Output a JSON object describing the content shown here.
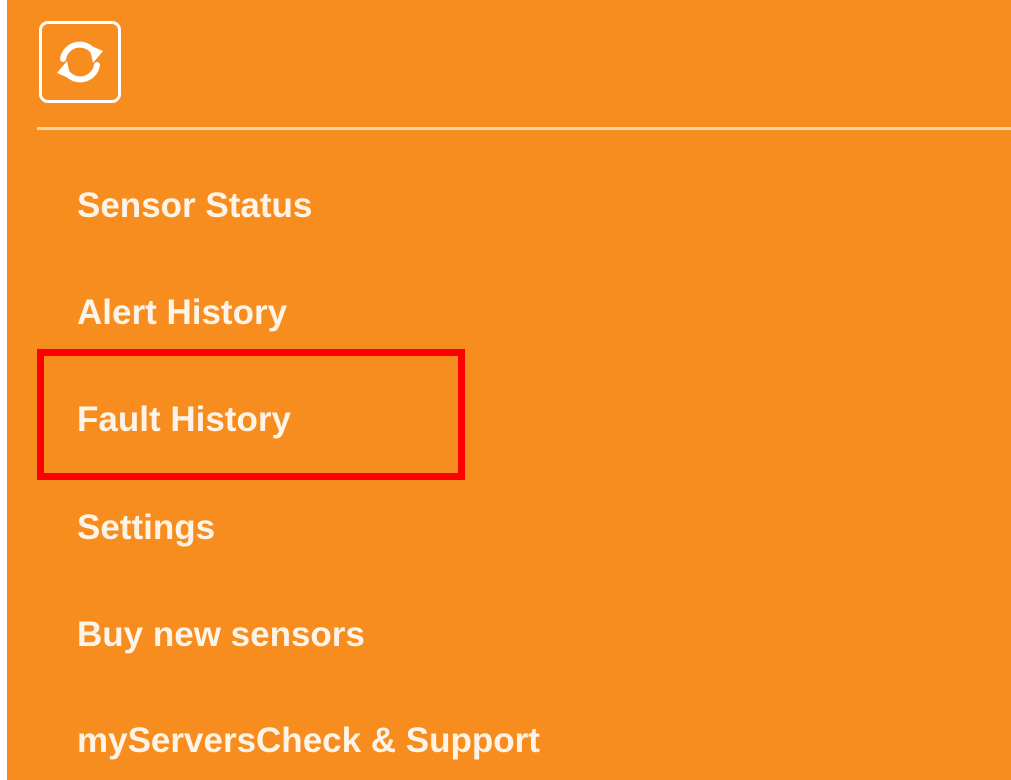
{
  "theme": {
    "background": "#f78d1e",
    "text": "#fdf3e6",
    "divider": "#fbd4a6",
    "highlight": "#ff0000"
  },
  "header": {
    "refresh_icon": "refresh-icon"
  },
  "nav": {
    "items": [
      {
        "label": "Sensor Status"
      },
      {
        "label": "Alert History"
      },
      {
        "label": "Fault History",
        "highlighted": true
      },
      {
        "label": "Settings"
      },
      {
        "label": "Buy new sensors"
      },
      {
        "label": "myServersCheck & Support"
      }
    ]
  }
}
